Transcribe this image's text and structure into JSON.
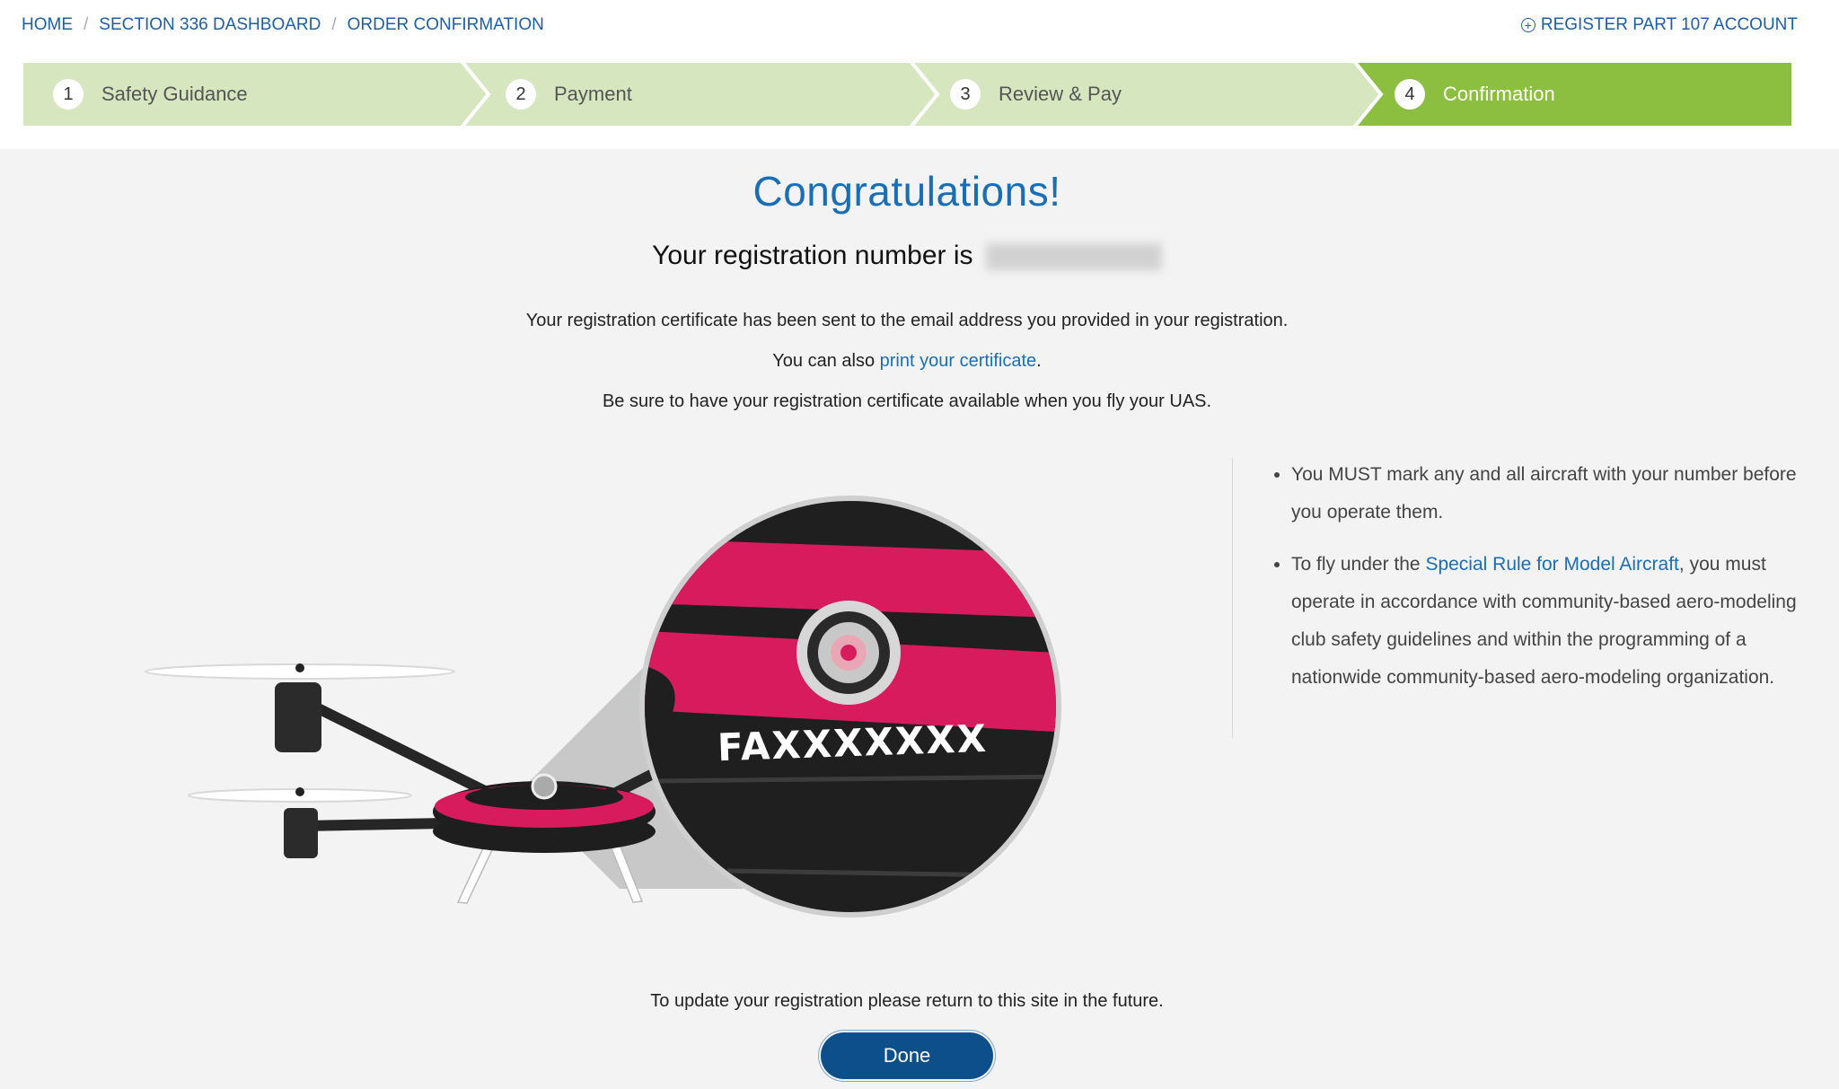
{
  "breadcrumb": {
    "items": [
      "HOME",
      "SECTION 336 DASHBOARD",
      "ORDER CONFIRMATION"
    ],
    "separator": "/"
  },
  "header_link": {
    "label": "REGISTER PART 107 ACCOUNT",
    "icon": "plus-circle-icon"
  },
  "steps": [
    {
      "number": "1",
      "label": "Safety Guidance",
      "state": "complete"
    },
    {
      "number": "2",
      "label": "Payment",
      "state": "complete"
    },
    {
      "number": "3",
      "label": "Review & Pay",
      "state": "complete"
    },
    {
      "number": "4",
      "label": "Confirmation",
      "state": "active"
    }
  ],
  "main": {
    "heading": "Congratulations!",
    "registration_prefix": "Your registration number is",
    "registration_number_hidden": true,
    "line1": "Your registration certificate has been sent to the email address you provided in your registration.",
    "line2_prefix": "You can also",
    "line2_link": "print your certificate",
    "line2_suffix": ".",
    "line3": "Be sure to have your registration certificate available when you fly your UAS."
  },
  "illustration": {
    "marking_text": "FAXXXXXXX"
  },
  "notes": {
    "bullet1": "You MUST mark any and all aircraft with your number before you operate them.",
    "bullet2_prefix": "To fly under the",
    "bullet2_link": "Special Rule for Model Aircraft",
    "bullet2_suffix": ", you must operate in accordance with community-based aero-modeling club safety guidelines and within the programming of a nationwide community-based aero-modeling organization."
  },
  "footer": {
    "update_text": "To update your registration please return to this site in the future.",
    "done_label": "Done"
  },
  "colors": {
    "link_blue": "#1a6eb5",
    "step_inactive": "#d6e6bf",
    "step_active": "#8cbf3f",
    "button_blue": "#0d4f8a",
    "drone_pink": "#d81b5c"
  }
}
